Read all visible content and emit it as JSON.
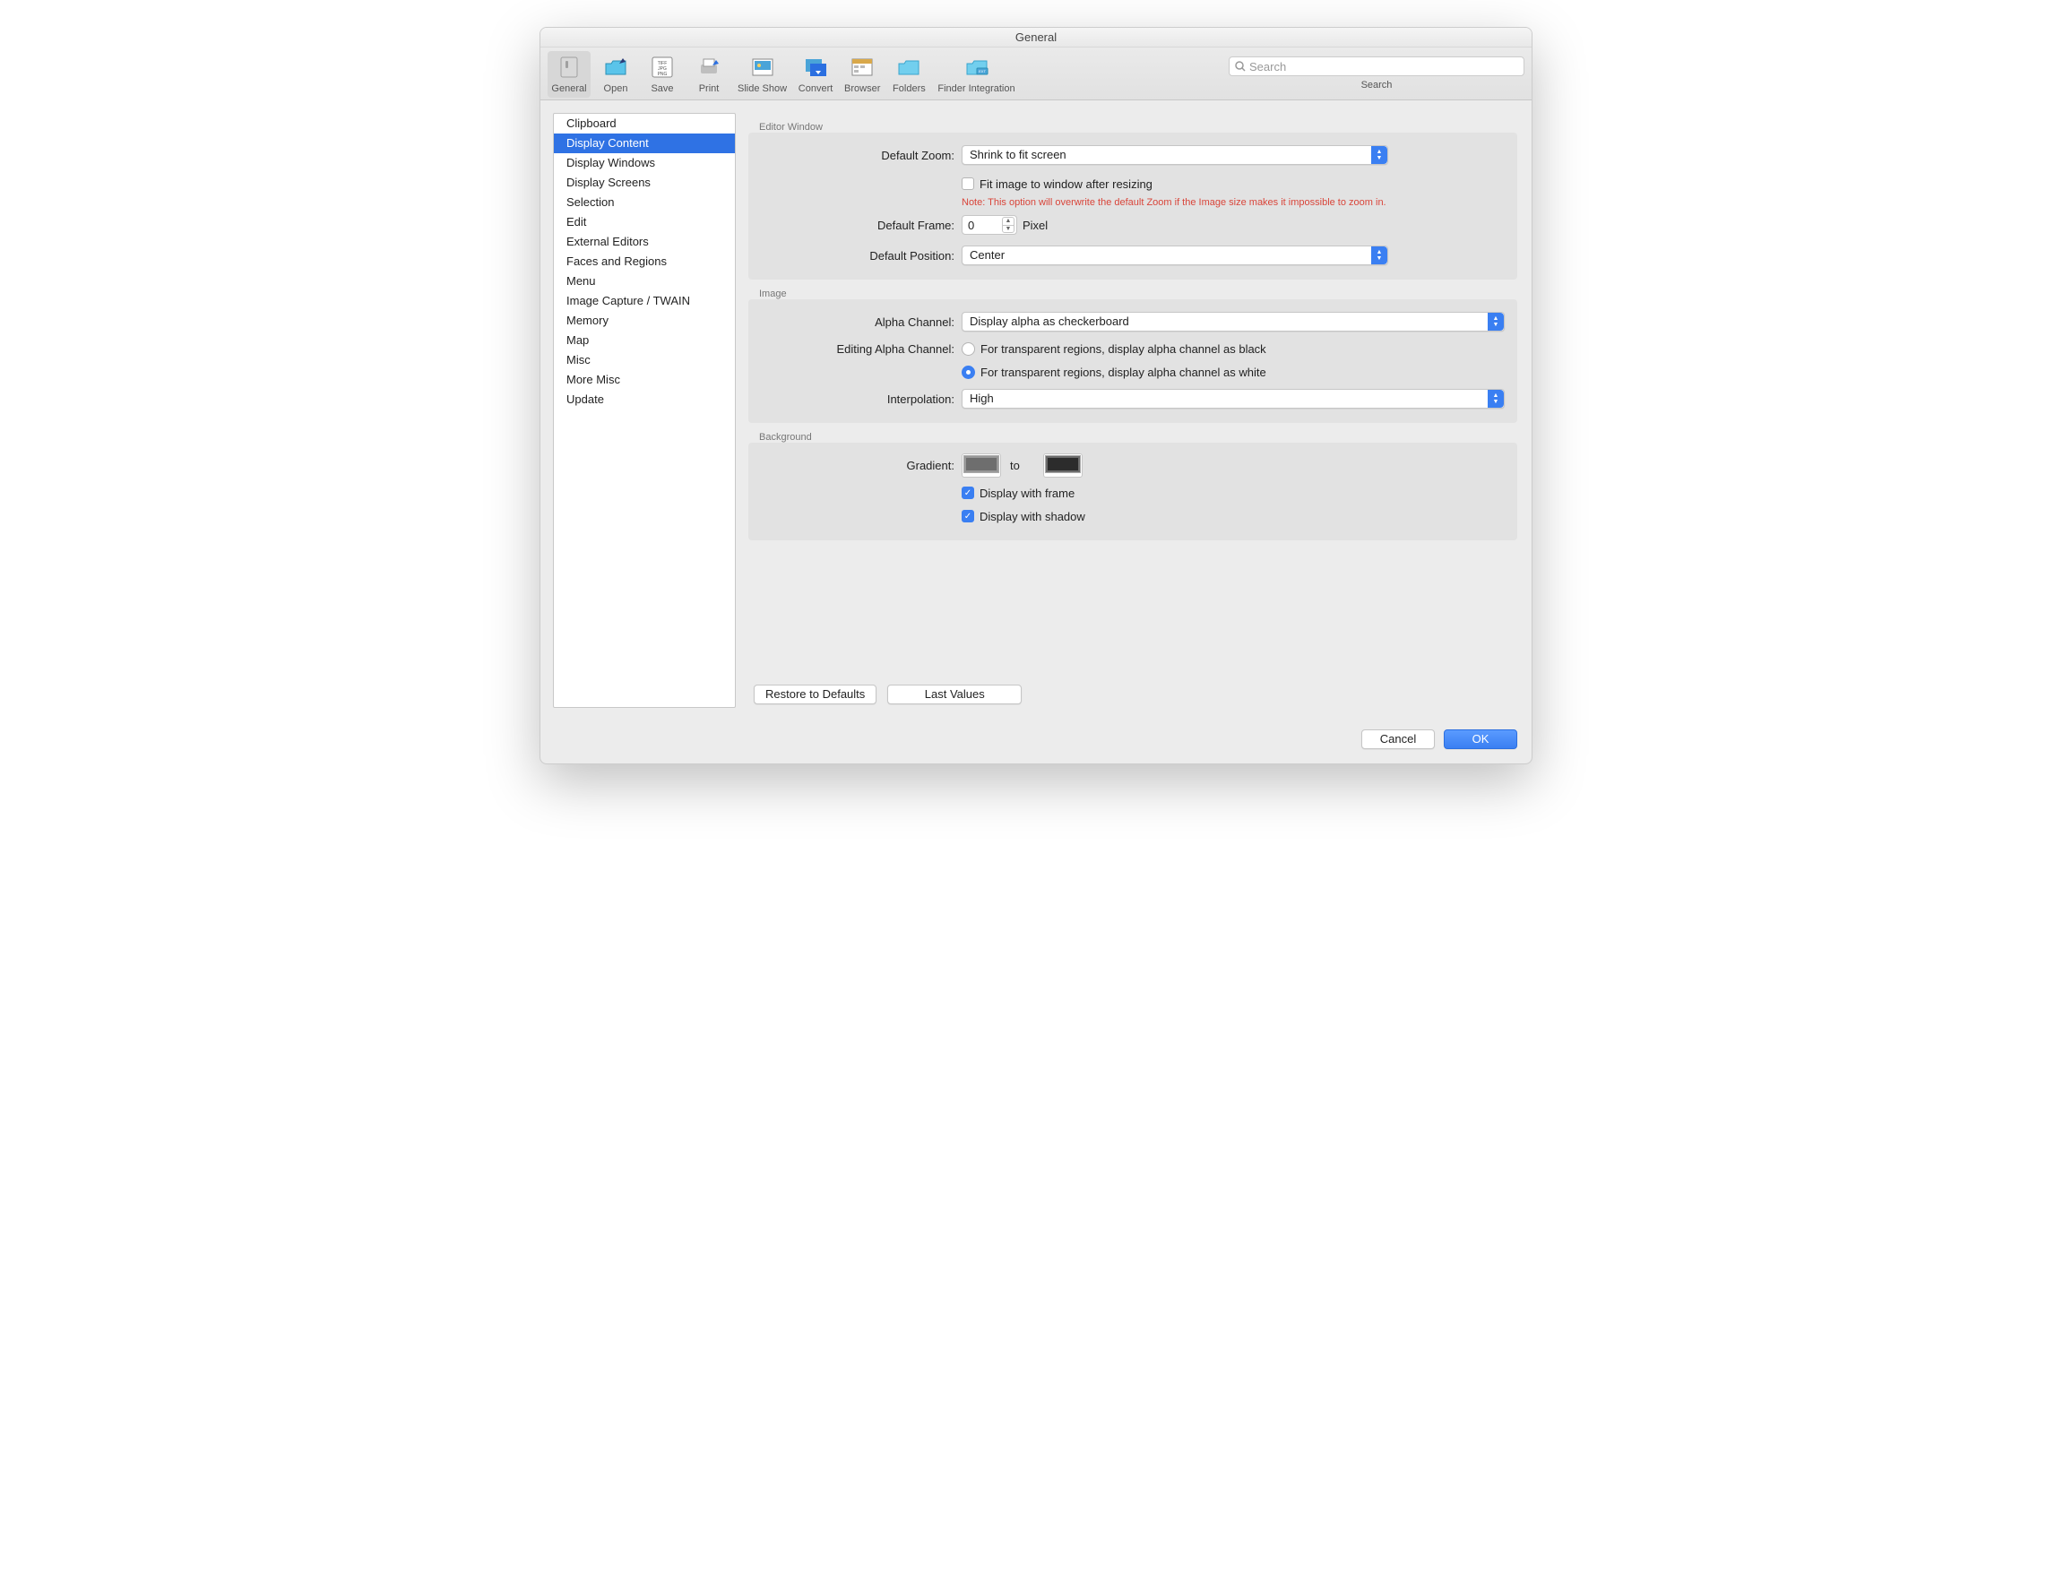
{
  "window": {
    "title": "General"
  },
  "toolbar": {
    "items": [
      {
        "label": "General"
      },
      {
        "label": "Open"
      },
      {
        "label": "Save"
      },
      {
        "label": "Print"
      },
      {
        "label": "Slide Show"
      },
      {
        "label": "Convert"
      },
      {
        "label": "Browser"
      },
      {
        "label": "Folders"
      },
      {
        "label": "Finder Integration"
      }
    ],
    "search_label": "Search",
    "search_placeholder": "Search"
  },
  "sidebar": {
    "items": [
      "Clipboard",
      "Display Content",
      "Display Windows",
      "Display Screens",
      "Selection",
      "Edit",
      "External Editors",
      "Faces and Regions",
      "Menu",
      "Image Capture / TWAIN",
      "Memory",
      "Map",
      "Misc",
      "More Misc",
      "Update"
    ],
    "selected_index": 1
  },
  "sections": {
    "editor": {
      "title": "Editor Window",
      "default_zoom_label": "Default Zoom:",
      "default_zoom_value": "Shrink to fit screen",
      "fit_checkbox_label": "Fit image to window after resizing",
      "fit_note": "Note: This option will overwrite the default Zoom if the Image size makes it impossible to zoom in.",
      "default_frame_label": "Default Frame:",
      "default_frame_value": "0",
      "default_frame_unit": "Pixel",
      "default_position_label": "Default Position:",
      "default_position_value": "Center"
    },
    "image": {
      "title": "Image",
      "alpha_channel_label": "Alpha Channel:",
      "alpha_channel_value": "Display alpha as checkerboard",
      "editing_alpha_label": "Editing Alpha Channel:",
      "radio_black": "For transparent regions, display alpha channel as black",
      "radio_white": "For transparent regions, display alpha channel as white",
      "interpolation_label": "Interpolation:",
      "interpolation_value": "High"
    },
    "background": {
      "title": "Background",
      "gradient_label": "Gradient:",
      "gradient_to": "to",
      "display_frame": "Display with frame",
      "display_shadow": "Display with shadow"
    }
  },
  "buttons": {
    "restore": "Restore to Defaults",
    "last_values": "Last Values",
    "cancel": "Cancel",
    "ok": "OK"
  }
}
